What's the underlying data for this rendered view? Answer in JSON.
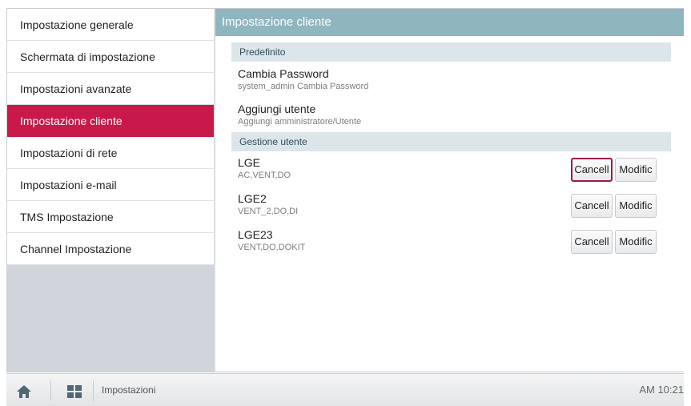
{
  "sidebar": {
    "items": [
      {
        "label": "Impostazione generale"
      },
      {
        "label": "Schermata di impostazione"
      },
      {
        "label": "Impostazioni avanzate"
      },
      {
        "label": "Impostazione cliente"
      },
      {
        "label": "Impostazioni di rete"
      },
      {
        "label": "Impostazioni e-mail"
      },
      {
        "label": "TMS Impostazione"
      },
      {
        "label": "Channel Impostazione"
      }
    ],
    "active_index": 3,
    "active_color": "#c8194a"
  },
  "main": {
    "title": "Impostazione cliente",
    "sections": {
      "default": {
        "heading": "Predefinito",
        "items": [
          {
            "title": "Cambia Password",
            "subtitle": "system_admin Cambia Password"
          },
          {
            "title": "Aggiungi utente",
            "subtitle": "Aggiungi amministratore/Utente"
          }
        ]
      },
      "users": {
        "heading": "Gestione utente",
        "rows": [
          {
            "name": "LGE",
            "perms": "AC,VENT,DO"
          },
          {
            "name": "LGE2",
            "perms": "VENT_2,DO,DI"
          },
          {
            "name": "LGE23",
            "perms": "VENT,DO,DOKIT"
          }
        ]
      }
    },
    "buttons": {
      "cancel": "Cancell",
      "modify": "Modific"
    },
    "header_color": "#8fb5bf"
  },
  "bottom_bar": {
    "home_icon": "home-icon",
    "apps_icon": "grid-icon",
    "breadcrumb": "Impostazioni",
    "time": "AM 10:21"
  }
}
